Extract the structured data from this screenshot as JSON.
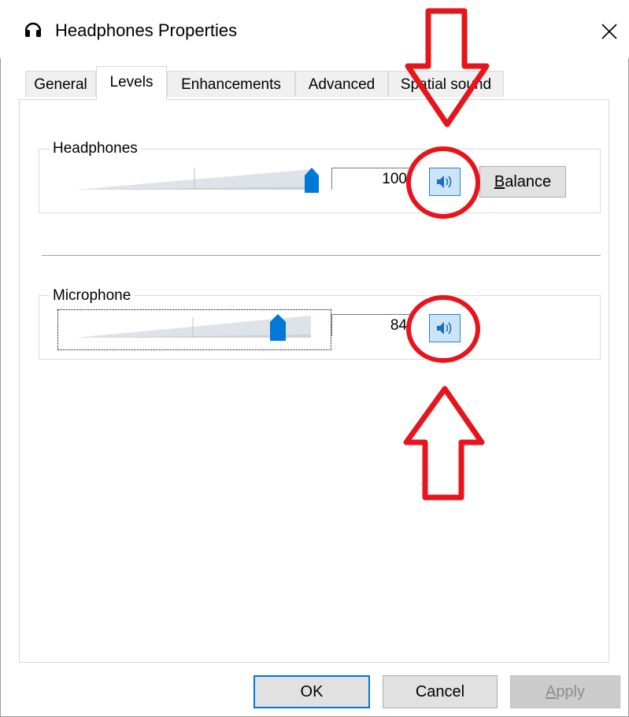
{
  "window": {
    "title": "Headphones Properties",
    "close_glyph": "✕"
  },
  "tabs": [
    {
      "label": "General",
      "active": false
    },
    {
      "label": "Levels",
      "active": true
    },
    {
      "label": "Enhancements",
      "active": false
    },
    {
      "label": "Advanced",
      "active": false
    },
    {
      "label": "Spatial sound",
      "active": false
    }
  ],
  "levels": {
    "headphones": {
      "label": "Headphones",
      "value": "100",
      "level": 1.0,
      "mute_icon": "speaker-icon",
      "balance_label": "Balance",
      "balance_mnemonic": "B"
    },
    "microphone": {
      "label": "Microphone",
      "value": "84",
      "level": 0.84,
      "mute_icon": "speaker-icon"
    }
  },
  "footer": {
    "ok": "OK",
    "cancel": "Cancel",
    "apply": "Apply"
  },
  "colors": {
    "accent": "#0078d7",
    "annotation_red": "#e8141b",
    "speaker_button_bg": "#cce4f7"
  }
}
